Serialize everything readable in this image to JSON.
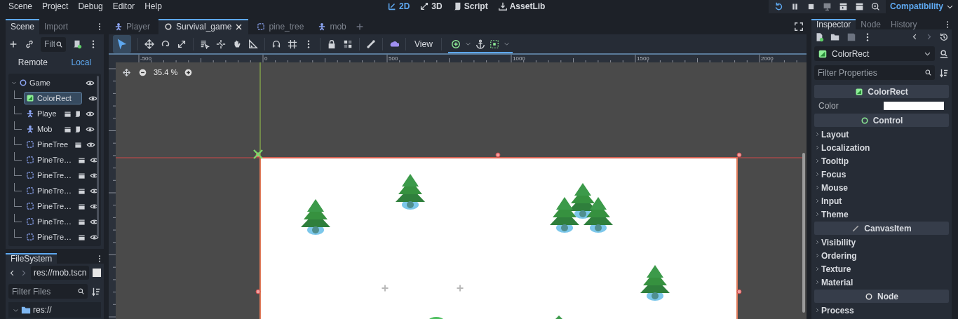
{
  "menu": [
    "Scene",
    "Project",
    "Debug",
    "Editor",
    "Help"
  ],
  "workspaces": [
    {
      "label": "2D",
      "kind": "plane",
      "selected": true
    },
    {
      "label": "3D",
      "kind": "space",
      "selected": false
    },
    {
      "label": "Script",
      "kind": "script",
      "selected": false
    },
    {
      "label": "AssetLib",
      "kind": "assetlib",
      "selected": false
    }
  ],
  "renderer": "Compatibility",
  "scene_dock": {
    "tabs": [
      {
        "label": "Scene",
        "selected": true
      },
      {
        "label": "Import",
        "selected": false
      }
    ],
    "filter": {
      "placeholder": "Filt"
    },
    "modes": [
      {
        "label": "Remote",
        "selected": false
      },
      {
        "label": "Local",
        "selected": true
      }
    ],
    "tree": {
      "name": "Game",
      "kind": "node2d",
      "expanded": true,
      "visible": true,
      "children": [
        {
          "name": "ColorRect",
          "kind": "colorrect",
          "selected": true,
          "instanced": false,
          "scripted": false,
          "visible": true
        },
        {
          "name": "Playe",
          "kind": "character",
          "selected": false,
          "instanced": true,
          "scripted": true,
          "visible": true
        },
        {
          "name": "Mob",
          "kind": "character",
          "selected": false,
          "instanced": true,
          "scripted": true,
          "visible": true
        },
        {
          "name": "PineTree",
          "kind": "sprite",
          "selected": false,
          "instanced": true,
          "scripted": false,
          "visible": true
        },
        {
          "name": "PineTre…",
          "kind": "sprite",
          "selected": false,
          "instanced": true,
          "scripted": false,
          "visible": true
        },
        {
          "name": "PineTre…",
          "kind": "sprite",
          "selected": false,
          "instanced": true,
          "scripted": false,
          "visible": true
        },
        {
          "name": "PineTre…",
          "kind": "sprite",
          "selected": false,
          "instanced": true,
          "scripted": false,
          "visible": true
        },
        {
          "name": "PineTre…",
          "kind": "sprite",
          "selected": false,
          "instanced": true,
          "scripted": false,
          "visible": true
        },
        {
          "name": "PineTre…",
          "kind": "sprite",
          "selected": false,
          "instanced": true,
          "scripted": false,
          "visible": true
        },
        {
          "name": "PineTre…",
          "kind": "sprite",
          "selected": false,
          "instanced": true,
          "scripted": false,
          "visible": true
        }
      ]
    }
  },
  "filesystem": {
    "tab": "FileSystem",
    "path": "res://mob.tscn",
    "filter": {
      "placeholder": "Filter Files"
    },
    "root": {
      "name": "res://",
      "expanded": true
    }
  },
  "editor_tabs": [
    {
      "label": "Player",
      "kind": "character",
      "selected": false
    },
    {
      "label": "Survival_game",
      "kind": "node",
      "selected": true
    },
    {
      "label": "pine_tree",
      "kind": "sprite",
      "selected": false
    },
    {
      "label": "mob",
      "kind": "character",
      "selected": false
    }
  ],
  "toolbar": {
    "view_button": "View"
  },
  "viewport": {
    "zoom": "35.4 %",
    "ruler_labels": [
      "-500",
      "0",
      "500",
      "1000",
      "1500",
      "2000"
    ]
  },
  "inspector": {
    "tabs": [
      {
        "label": "Inspector",
        "selected": true
      },
      {
        "label": "Node",
        "selected": false
      },
      {
        "label": "History",
        "selected": false
      }
    ],
    "object": "ColorRect",
    "filter": {
      "placeholder": "Filter Properties"
    },
    "sections": [
      {
        "title": "ColorRect",
        "kind": "colorrect",
        "properties": [
          {
            "label": "Color"
          }
        ]
      },
      {
        "title": "Control",
        "kind": "control",
        "groups": [
          {
            "label": "Layout",
            "expanded": false
          },
          {
            "label": "Localization",
            "expanded": false
          },
          {
            "label": "Tooltip",
            "expanded": false
          },
          {
            "label": "Focus",
            "expanded": false
          },
          {
            "label": "Mouse",
            "expanded": false
          },
          {
            "label": "Input",
            "expanded": false
          },
          {
            "label": "Theme",
            "expanded": false
          }
        ]
      },
      {
        "title": "CanvasItem",
        "kind": "canvasitem",
        "groups": [
          {
            "label": "Visibility",
            "expanded": false
          },
          {
            "label": "Ordering",
            "expanded": false
          },
          {
            "label": "Texture",
            "expanded": false
          },
          {
            "label": "Material",
            "expanded": false
          }
        ]
      },
      {
        "title": "Node",
        "kind": "node",
        "groups": [
          {
            "label": "Process",
            "expanded": false
          }
        ]
      }
    ]
  }
}
